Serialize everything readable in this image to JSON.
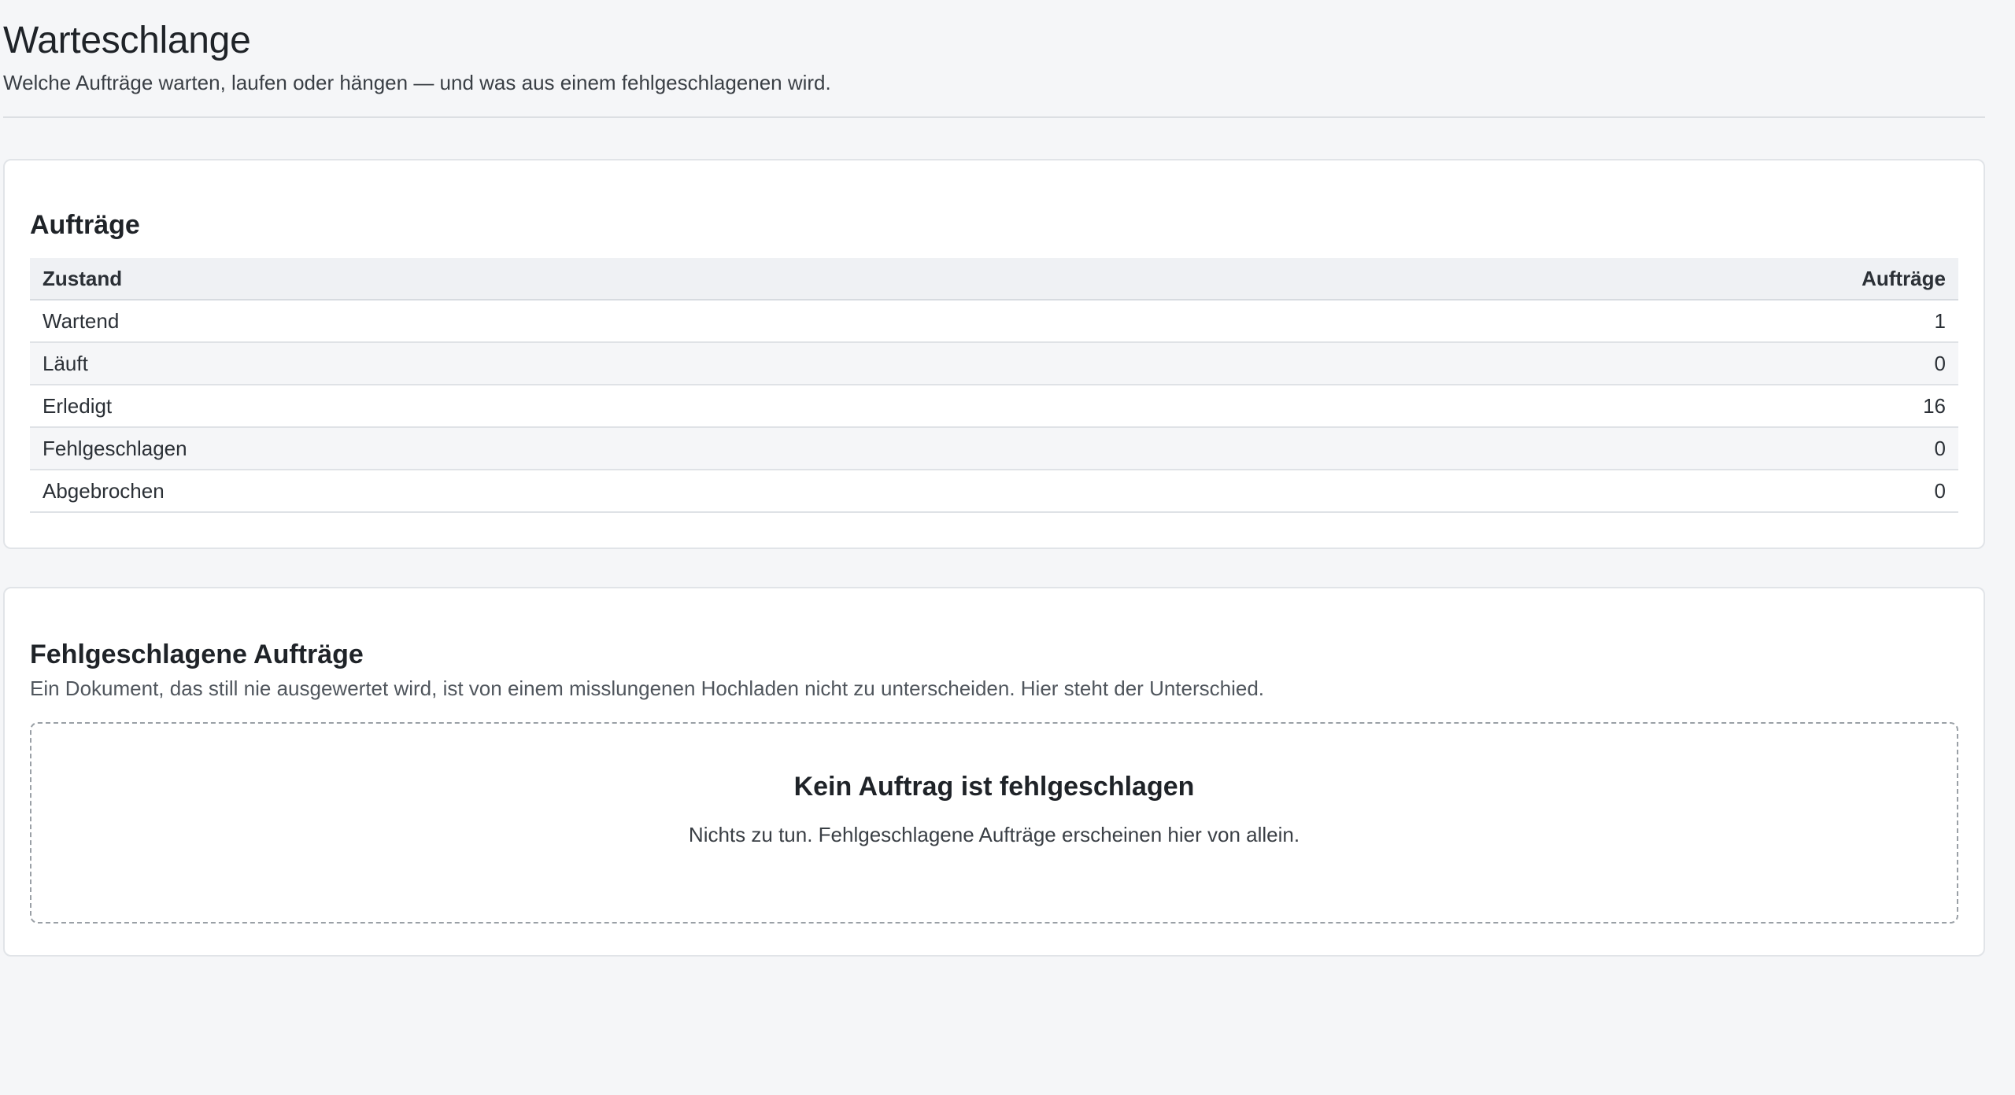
{
  "header": {
    "title": "Warteschlange",
    "subtitle": "Welche Aufträge warten, laufen oder hängen — und was aus einem fehlgeschlagenen wird."
  },
  "jobs": {
    "title": "Aufträge",
    "columns": {
      "state": "Zustand",
      "count": "Aufträge"
    },
    "rows": [
      {
        "state": "Wartend",
        "count": "1"
      },
      {
        "state": "Läuft",
        "count": "0"
      },
      {
        "state": "Erledigt",
        "count": "16"
      },
      {
        "state": "Fehlgeschlagen",
        "count": "0"
      },
      {
        "state": "Abgebrochen",
        "count": "0"
      }
    ]
  },
  "failed": {
    "title": "Fehlgeschlagene Aufträge",
    "description": "Ein Dokument, das still nie ausgewertet wird, ist von einem misslungenen Hochladen nicht zu unterscheiden. Hier steht der Unterschied.",
    "empty_title": "Kein Auftrag ist fehlgeschlagen",
    "empty_text": "Nichts zu tun. Fehlgeschlagene Aufträge erscheinen hier von allein."
  }
}
